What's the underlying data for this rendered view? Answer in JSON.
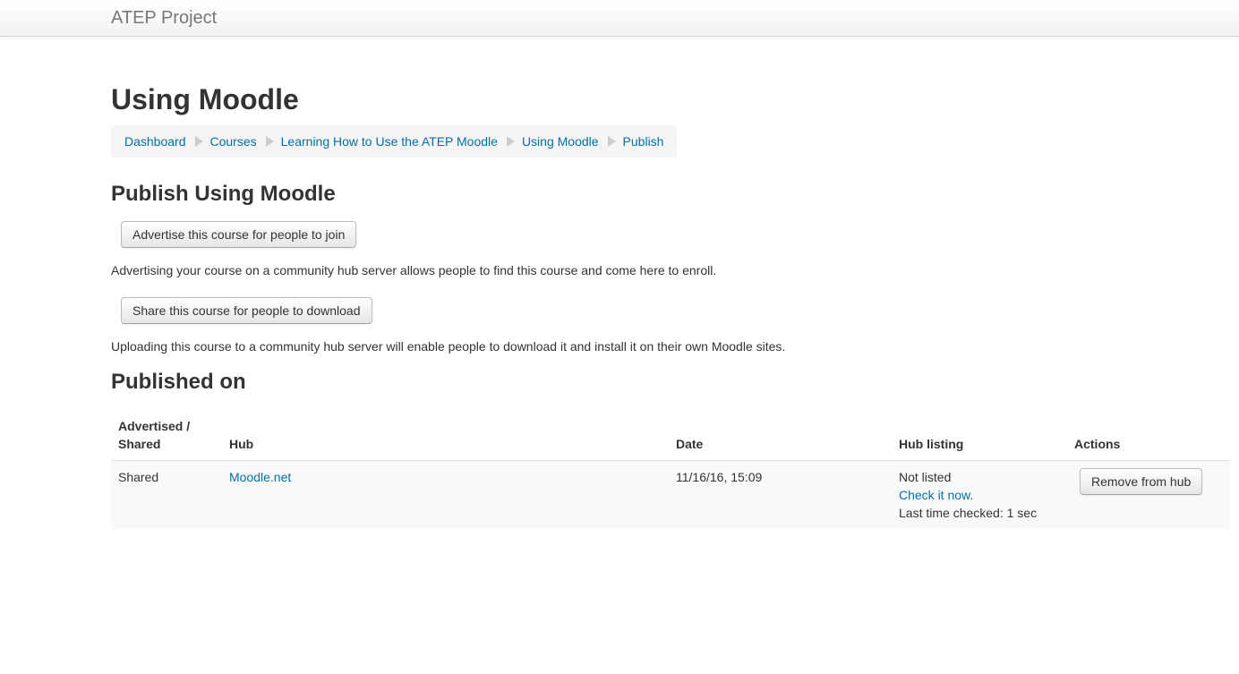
{
  "navbar": {
    "brand": "ATEP Project"
  },
  "page": {
    "heading": "Using Moodle"
  },
  "breadcrumb": {
    "items": [
      "Dashboard",
      "Courses",
      "Learning How to Use the ATEP Moodle",
      "Using Moodle",
      "Publish"
    ]
  },
  "publish": {
    "heading": "Publish Using Moodle",
    "advertise_button": "Advertise this course for people to join",
    "advertise_desc": "Advertising your course on a community hub server allows people to find this course and come here to enroll.",
    "share_button": "Share this course for people to download",
    "share_desc": "Uploading this course to a community hub server will enable people to download it and install it on their own Moodle sites."
  },
  "published_on": {
    "heading": "Published on",
    "columns": {
      "advertised_shared_line1": "Advertised /",
      "advertised_shared_line2": "Shared",
      "hub": "Hub",
      "date": "Date",
      "hub_listing": "Hub listing",
      "actions": "Actions"
    },
    "rows": [
      {
        "type": "Shared",
        "hub": "Moodle.net",
        "date": "11/16/16, 15:09",
        "listing_status": "Not listed",
        "check_link": "Check it now.",
        "last_checked": "Last time checked: 1 sec",
        "action_button": "Remove from hub"
      }
    ]
  },
  "colors": {
    "link": "#0070a8",
    "text": "#333333",
    "brand": "#777777",
    "breadcrumb_bg": "#f5f5f5",
    "row_bg": "#f9f9f9"
  }
}
